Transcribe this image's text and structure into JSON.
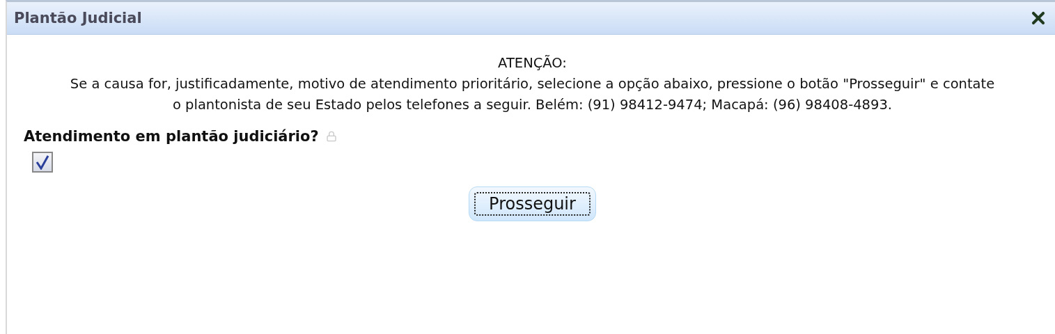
{
  "window": {
    "title": "Plantão Judicial"
  },
  "notice": {
    "heading": "ATENÇÃO:",
    "text": "Se a causa for, justificadamente, motivo de atendimento prioritário, selecione a opção abaixo, pressione o botão \"Prosseguir\" e contate o plantonista de seu Estado pelos telefones a seguir. Belém: (91) 98412-9474; Macapá: (96) 98408-4893."
  },
  "field": {
    "label": "Atendimento em plantão judiciário?",
    "checked": true
  },
  "buttons": [
    {
      "label": "Prosseguir",
      "focused": true
    }
  ]
}
